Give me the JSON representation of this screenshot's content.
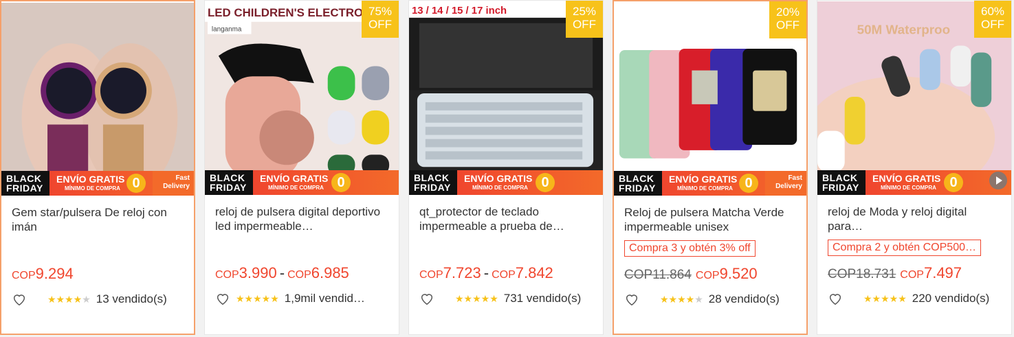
{
  "banner": {
    "black": "BLACK",
    "friday": "FRIDAY",
    "envio": "ENVÍO GRATIS",
    "minimo": "MÍNIMO DE COMPRA",
    "zero": "0",
    "fast1": "Fast",
    "fast2": "Delivery"
  },
  "products": [
    {
      "title": "Gem star/pulsera De reloj con imán",
      "cur": "COP",
      "price": "9.294",
      "stars": "★★★★",
      "stars_grey": "★",
      "sold": "13 vendido(s)"
    },
    {
      "title": "reloj de pulsera digital deportivo led impermeable…",
      "off_pct": "75%",
      "off": "OFF",
      "img_text": "LED CHILDREN'S ELECTRONIC W",
      "img_brand": "langanma",
      "cur": "COP",
      "price": "3.990",
      "dash": "-",
      "cur2": "COP",
      "price2": "6.985",
      "stars": "★★★★★",
      "sold": "1,9mil vendid…"
    },
    {
      "title": "qt_protector de teclado impermeable a prueba de…",
      "off_pct": "25%",
      "off": "OFF",
      "img_text": "13 / 14 / 15 / 17 inch",
      "cur": "COP",
      "price": "7.723",
      "dash": "-",
      "cur2": "COP",
      "price2": "7.842",
      "stars": "★★★★★",
      "sold": "731 vendido(s)"
    },
    {
      "title": "Reloj de pulsera Matcha Verde impermeable unisex",
      "off_pct": "20%",
      "off": "OFF",
      "promo": "Compra 3 y obtén 3% off",
      "old": "COP11.864",
      "cur": "COP",
      "price": "9.520",
      "stars": "★★★★",
      "stars_grey": "★",
      "sold": "28 vendido(s)"
    },
    {
      "title": "reloj de Moda y reloj digital para…",
      "off_pct": "60%",
      "off": "OFF",
      "img_text": "50M Waterproo",
      "promo": "Compra 2 y obtén COP500…",
      "old": "COP18.731",
      "cur": "COP",
      "price": "7.497",
      "stars": "★★★★★",
      "sold": "220 vendido(s)"
    }
  ]
}
